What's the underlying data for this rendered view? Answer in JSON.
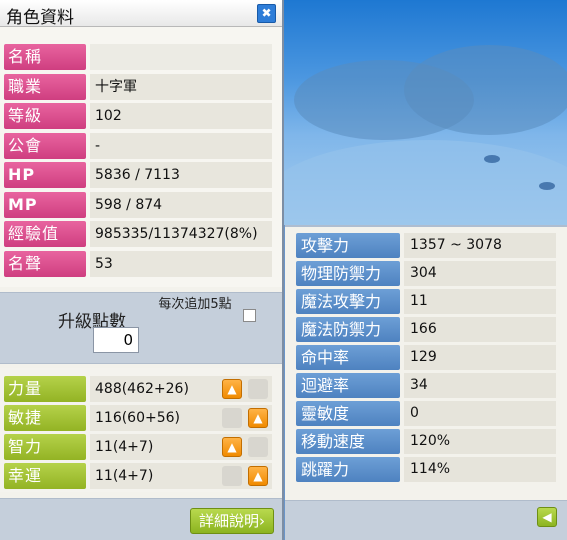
{
  "window": {
    "title": "角色資料",
    "close_glyph": "✖"
  },
  "info": {
    "name_label": "名稱",
    "name_value": "",
    "job_label": "職業",
    "job_value": "十字軍",
    "level_label": "等級",
    "level_value": "102",
    "guild_label": "公會",
    "guild_value": "-",
    "hp_label": "HP",
    "hp_value": "5836 / 7113",
    "mp_label": "MP",
    "mp_value": "598 / 874",
    "exp_label": "經驗值",
    "exp_value": "985335/11374327(8%)",
    "fame_label": "名聲",
    "fame_value": "53"
  },
  "level_up": {
    "label": "升級點數",
    "points": "0",
    "each_label": "每次追加5點",
    "each_checked": false
  },
  "stats": [
    {
      "label": "力量",
      "value": "488(462+26)"
    },
    {
      "label": "敏捷",
      "value": "116(60+56)"
    },
    {
      "label": "智力",
      "value": "11(4+7)"
    },
    {
      "label": "幸運",
      "value": "11(4+7)"
    }
  ],
  "detail_button": "詳細說明›",
  "detail_stats": [
    {
      "label": "攻擊力",
      "value": "1357 ~ 3078"
    },
    {
      "label": "物理防禦力",
      "value": "304"
    },
    {
      "label": "魔法攻擊力",
      "value": "11"
    },
    {
      "label": "魔法防禦力",
      "value": "166"
    },
    {
      "label": "命中率",
      "value": "129"
    },
    {
      "label": "迴避率",
      "value": "34"
    },
    {
      "label": "靈敏度",
      "value": "0"
    },
    {
      "label": "移動速度",
      "value": "120%"
    },
    {
      "label": "跳躍力",
      "value": "114%"
    }
  ],
  "icons": {
    "up_arrow": "arrow-up-icon",
    "back_arrow": "arrow-left-icon",
    "close": "close-icon"
  },
  "colors": {
    "pink_label": "#d94a8b",
    "green_label": "#a3c435",
    "blue_label": "#5a8ecb",
    "stat_button": "#f39a1a"
  }
}
